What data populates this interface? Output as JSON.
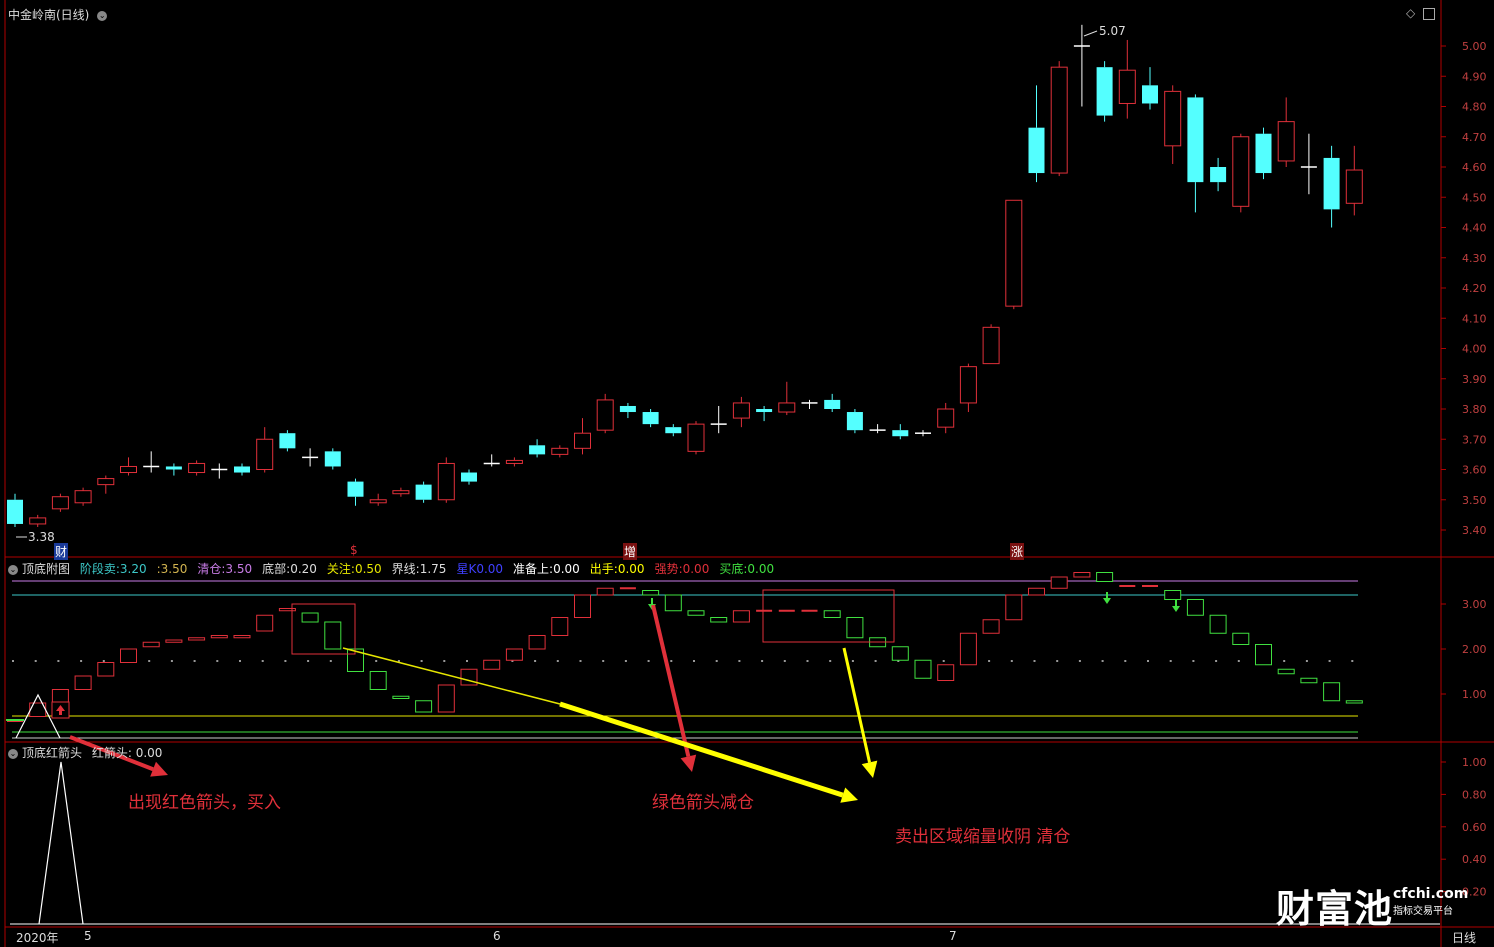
{
  "main_panel": {
    "title": "中金岭南(日线)",
    "high_label": "5.07",
    "low_label": "3.38",
    "y_ticks": [
      "5.00",
      "4.90",
      "4.80",
      "4.70",
      "4.60",
      "4.50",
      "4.40",
      "4.30",
      "4.20",
      "4.10",
      "4.00",
      "3.90",
      "3.80",
      "3.70",
      "3.60",
      "3.50",
      "3.40"
    ],
    "event_markers": [
      "财",
      "$",
      "增",
      "涨"
    ]
  },
  "indicator_panel": {
    "name": "顶底附图",
    "items": [
      {
        "label": "阶段卖:",
        "value": "3.20",
        "color": "#3cc8c8"
      },
      {
        "label": ":",
        "value": "3.50",
        "color": "#d2b450"
      },
      {
        "label": "清仓:",
        "value": "3.50",
        "color": "#c87ce6"
      },
      {
        "label": "底部:",
        "value": "0.20",
        "color": "#dddddd"
      },
      {
        "label": "关注:",
        "value": "0.50",
        "color": "#e6e600"
      },
      {
        "label": "界线:",
        "value": "1.75",
        "color": "#dddddd"
      },
      {
        "label": "星K",
        "value": "0.00",
        "color": "#4040ff"
      },
      {
        "label": "准备上:",
        "value": "0.00",
        "color": "#ffffff"
      },
      {
        "label": "出手:",
        "value": "0.00",
        "color": "#ffff00"
      },
      {
        "label": "强势:",
        "value": "0.00",
        "color": "#e0303a"
      },
      {
        "label": "买底:",
        "value": "0.00",
        "color": "#40e040"
      }
    ],
    "y_ticks": [
      "3.00",
      "2.00",
      "1.00"
    ]
  },
  "arrow_panel": {
    "name": "顶底红箭头",
    "label": "红箭头:",
    "value": "0.00",
    "y_ticks": [
      "1.00",
      "0.80",
      "0.60",
      "0.40",
      "0.20"
    ]
  },
  "x_axis": {
    "labels": [
      "2020年",
      "5",
      "6",
      "7"
    ],
    "period": "日线"
  },
  "annotations": {
    "buy": "出现红色箭头，买入",
    "reduce": "绿色箭头减仓",
    "clear": "卖出区域缩量收阴 清仓"
  },
  "watermark": {
    "brand": "财富池",
    "domain": "cfchi.com",
    "tagline": "指标交易平台"
  },
  "colors": {
    "up": "#e0303a",
    "down": "#54ffff",
    "ind_down": "#40e040",
    "axis": "#b00000",
    "arrow_yellow": "#ffff00"
  }
}
